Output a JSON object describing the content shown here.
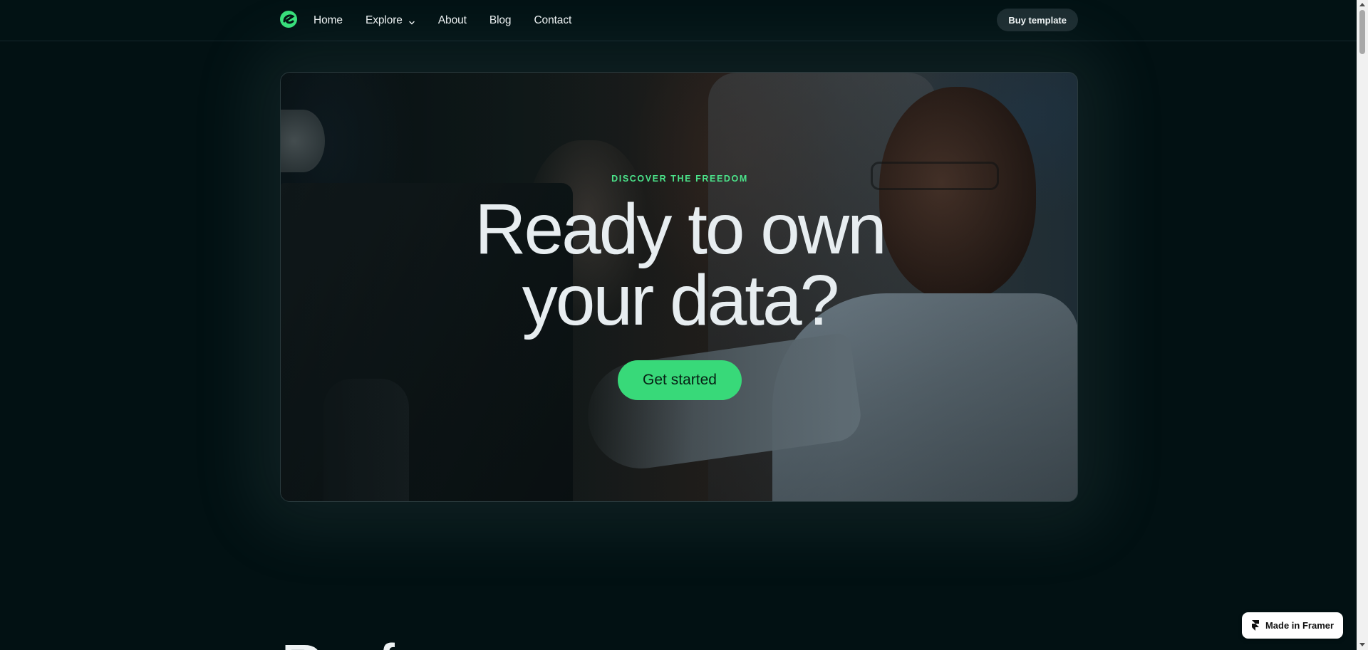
{
  "nav": {
    "logo_icon": "brand-logo-icon",
    "links": [
      {
        "label": "Home"
      },
      {
        "label": "Explore",
        "has_dropdown": true
      },
      {
        "label": "About"
      },
      {
        "label": "Blog"
      },
      {
        "label": "Contact"
      }
    ],
    "buy_label": "Buy template"
  },
  "hero": {
    "eyebrow": "DISCOVER THE FREEDOM",
    "headline_line1": "Ready to own",
    "headline_line2": "your data?",
    "cta_label": "Get started"
  },
  "next_section": {
    "heading_partial": "Perf"
  },
  "framer_badge": {
    "label": "Made in Framer",
    "icon": "framer-icon"
  },
  "colors": {
    "background": "#021113",
    "accent": "#38d979",
    "eyebrow": "#4be38a",
    "button_dark": "#1c2c30"
  }
}
